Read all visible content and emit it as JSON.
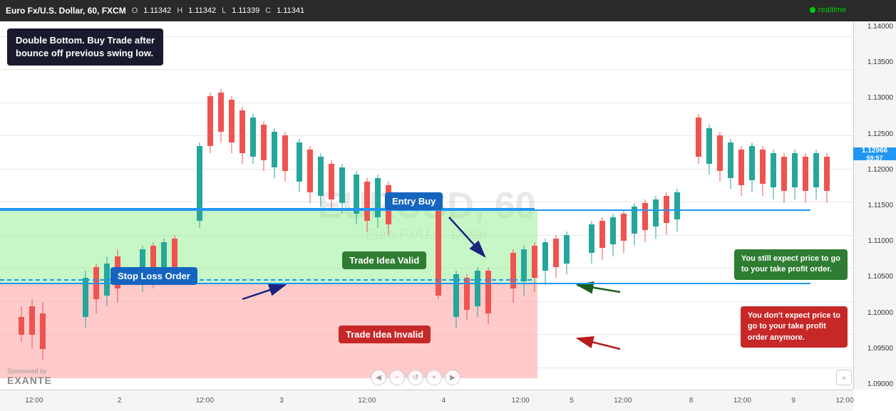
{
  "header": {
    "title": "Euro Fx/U.S. Dollar, 60, FXCM",
    "open_label": "O",
    "open_value": "1.11342",
    "high_label": "H",
    "high_value": "1.11342",
    "low_label": "L",
    "low_value": "1.11339",
    "close_label": "C",
    "close_value": "1.11341",
    "realtime": "realtime",
    "current_price": "1.12966",
    "current_time": "59:57"
  },
  "watermark": {
    "line1": "EURUSD, 60",
    "line2": "Euro Fx/U.S. Dollar"
  },
  "price_levels": [
    "1.14000",
    "1.13500",
    "1.13000",
    "1.12500",
    "1.12000",
    "1.11500",
    "1.11000",
    "1.10500",
    "1.10000",
    "1.09500",
    "1.09000"
  ],
  "time_labels": [
    {
      "x_pct": 5,
      "label": "12:00"
    },
    {
      "x_pct": 14,
      "label": "2"
    },
    {
      "x_pct": 24,
      "label": "12:00"
    },
    {
      "x_pct": 34,
      "label": "3"
    },
    {
      "x_pct": 44,
      "label": "12:00"
    },
    {
      "x_pct": 54,
      "label": "4"
    },
    {
      "x_pct": 62,
      "label": "12:00"
    },
    {
      "x_pct": 68,
      "label": "5"
    },
    {
      "x_pct": 74,
      "label": "12:00"
    },
    {
      "x_pct": 82,
      "label": "8"
    },
    {
      "x_pct": 88,
      "label": "12:00"
    },
    {
      "x_pct": 93,
      "label": "9"
    },
    {
      "x_pct": 98,
      "label": "12:00"
    }
  ],
  "annotations": {
    "intro_box": "Double Bottom. Buy Trade after\nbounce off previous swing low.",
    "entry_buy": "Entry Buy",
    "stop_loss": "Stop Loss Order",
    "trade_valid": "Trade Idea Valid",
    "trade_invalid": "Trade Idea Invalid",
    "right_green": "You still expect price to go\nto your take profit order.",
    "right_red": "You don't expect price to\ngo to your take profit\norder anymore."
  },
  "sponsored": {
    "by": "Sponsored by",
    "logo": "EXANTE"
  },
  "nav_buttons": [
    "◀",
    "−",
    "↺",
    "+",
    "▶"
  ],
  "colors": {
    "bullish_candle": "#26a69a",
    "bearish_candle": "#ef5350",
    "entry_line": "#2196F3",
    "stop_loss_line": "#2196F3",
    "zone_valid_bg": "rgba(144,238,144,0.5)",
    "zone_invalid_bg": "rgba(255,150,150,0.5)",
    "ann_blue": "#1565C0",
    "ann_green": "#2e7d32",
    "ann_red": "#c62828"
  }
}
